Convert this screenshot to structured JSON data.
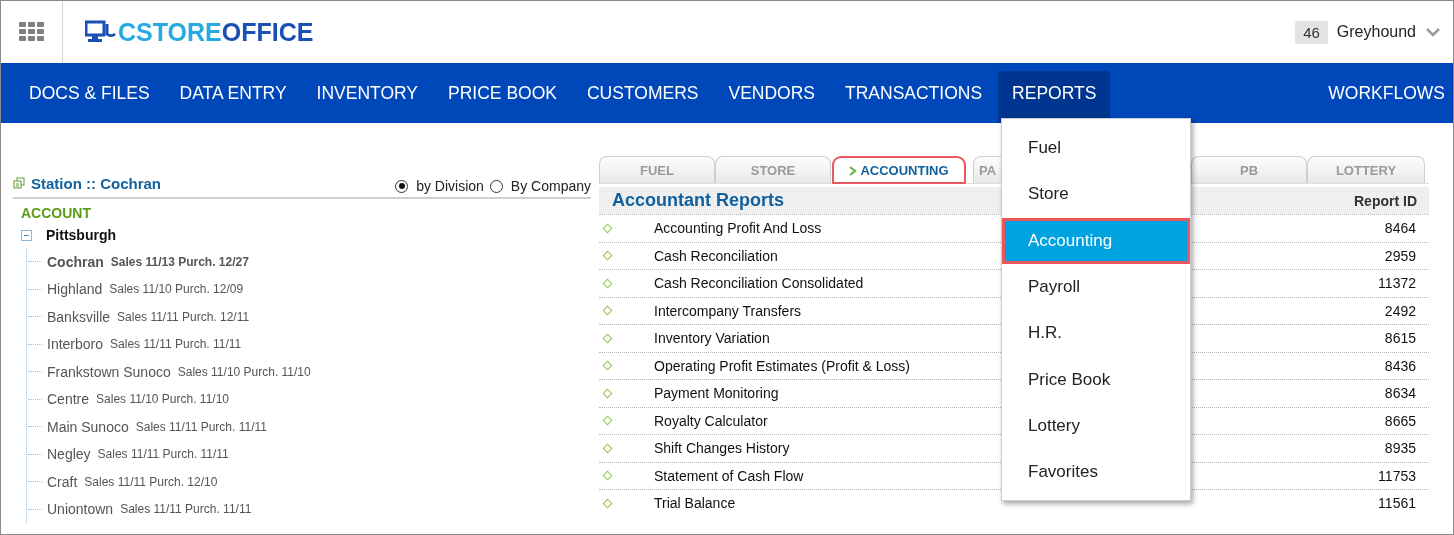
{
  "header": {
    "logo_left": "CSTORE",
    "logo_right": "OFFICE",
    "store_number": "46",
    "user": "Greyhound"
  },
  "nav": [
    {
      "label": "DOCS & FILES",
      "selected": false
    },
    {
      "label": "DATA ENTRY",
      "selected": false
    },
    {
      "label": "INVENTORY",
      "selected": false
    },
    {
      "label": "PRICE BOOK",
      "selected": false
    },
    {
      "label": "CUSTOMERS",
      "selected": false
    },
    {
      "label": "VENDORS",
      "selected": false
    },
    {
      "label": "TRANSACTIONS",
      "selected": false
    },
    {
      "label": "REPORTS",
      "selected": true
    },
    {
      "label": "WORKFLOWS",
      "selected": false
    }
  ],
  "left_panel": {
    "title": "Station :: Cochran",
    "radios": [
      {
        "label": "by Division",
        "selected": true
      },
      {
        "label": "By Company",
        "selected": false
      }
    ],
    "tree_heading": "ACCOUNT",
    "tree": [
      {
        "name": "Pittsburgh",
        "expanded": true,
        "children": [
          {
            "name": "Cochran",
            "dates": "Sales 11/13 Purch. 12/27",
            "selected": true
          },
          {
            "name": "Highland",
            "dates": "Sales 11/10 Purch. 12/09",
            "selected": false
          },
          {
            "name": "Banksville",
            "dates": "Sales 11/11 Purch. 12/11",
            "selected": false
          },
          {
            "name": "Interboro",
            "dates": "Sales 11/11 Purch. 11/11",
            "selected": false
          },
          {
            "name": "Frankstown Sunoco",
            "dates": "Sales 11/10 Purch. 11/10",
            "selected": false
          },
          {
            "name": "Centre",
            "dates": "Sales 11/10 Purch. 11/10",
            "selected": false
          },
          {
            "name": "Main Sunoco",
            "dates": "Sales 11/11 Purch. 11/11",
            "selected": false
          },
          {
            "name": "Negley",
            "dates": "Sales 11/11 Purch. 11/11",
            "selected": false
          },
          {
            "name": "Craft",
            "dates": "Sales 11/11 Purch. 12/10",
            "selected": false
          },
          {
            "name": "Uniontown",
            "dates": "Sales 11/11 Purch. 11/11",
            "selected": false
          }
        ]
      }
    ]
  },
  "report_tabs": [
    {
      "label": "FUEL",
      "selected": false
    },
    {
      "label": "STORE",
      "selected": false
    },
    {
      "label": "ACCOUNTING",
      "selected": true
    },
    {
      "label": "PA",
      "selected": false
    },
    {
      "label": "PB",
      "selected": false
    },
    {
      "label": "LOTTERY",
      "selected": false
    }
  ],
  "reports": {
    "title": "Accountant Reports",
    "id_header": "Report ID",
    "rows": [
      {
        "name": "Accounting Profit And Loss",
        "id": "8464"
      },
      {
        "name": "Cash Reconciliation",
        "id": "2959"
      },
      {
        "name": "Cash Reconciliation Consolidated",
        "id": "11372"
      },
      {
        "name": "Intercompany Transfers",
        "id": "2492"
      },
      {
        "name": "Inventory Variation",
        "id": "8615"
      },
      {
        "name": "Operating Profit Estimates (Profit & Loss)",
        "id": "8436"
      },
      {
        "name": "Payment Monitoring",
        "id": "8634"
      },
      {
        "name": "Royalty Calculator",
        "id": "8665"
      },
      {
        "name": "Shift Changes History",
        "id": "8935"
      },
      {
        "name": "Statement of Cash Flow",
        "id": "11753"
      },
      {
        "name": "Trial Balance",
        "id": "11561"
      }
    ]
  },
  "reports_menu": [
    {
      "label": "Fuel",
      "selected": false
    },
    {
      "label": "Store",
      "selected": false
    },
    {
      "label": "Accounting",
      "selected": true
    },
    {
      "label": "Payroll",
      "selected": false
    },
    {
      "label": "H.R.",
      "selected": false
    },
    {
      "label": "Price Book",
      "selected": false
    },
    {
      "label": "Lottery",
      "selected": false
    },
    {
      "label": "Favorites",
      "selected": false
    }
  ]
}
